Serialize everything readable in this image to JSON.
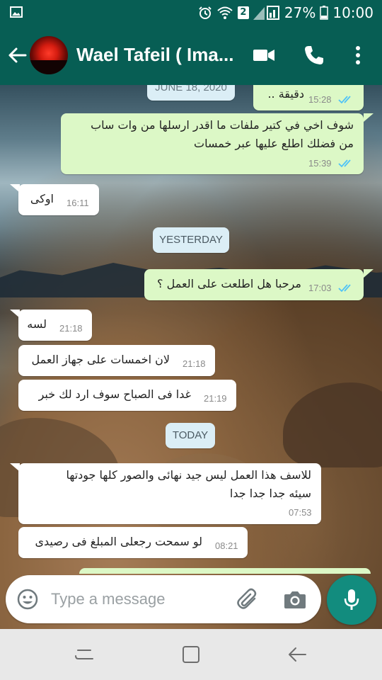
{
  "status_bar": {
    "battery": "27%",
    "time": "10:00",
    "sim_badge": "2",
    "icons": [
      "image-icon",
      "alarm-icon",
      "wifi-icon",
      "signal-icon",
      "battery-icon"
    ]
  },
  "header": {
    "contact_name": "Wael Tafeil ( Ima...",
    "actions": [
      "video-call-icon",
      "voice-call-icon",
      "more-options-icon"
    ]
  },
  "colors": {
    "header_bg": "#075e54",
    "outgoing_bubble": "#dcf8c6",
    "incoming_bubble": "#ffffff",
    "read_ticks": "#4fc3f7",
    "fab": "#128c7e"
  },
  "dates": {
    "partial": "JUNE 18, 2020",
    "yesterday": "YESTERDAY",
    "today": "TODAY"
  },
  "messages": [
    {
      "id": "m1",
      "direction": "out",
      "text": "دقيقة ..",
      "time": "15:28",
      "read": true
    },
    {
      "id": "m2",
      "direction": "out",
      "text_lines": [
        "شوف اخي في كتير ملفات ما اقدر ارسلها من وات ساب",
        "من فضلك اطلع عليها عبر خمسات"
      ],
      "time": "15:39",
      "read": true
    },
    {
      "id": "m3",
      "direction": "in",
      "text": "اوكى",
      "time": "16:11"
    },
    {
      "id": "m4",
      "direction": "out",
      "text": "مرحبا هل اطلعت على العمل ؟",
      "time": "17:03",
      "read": true
    },
    {
      "id": "m5",
      "direction": "in",
      "text": "لسه",
      "time": "21:18"
    },
    {
      "id": "m6",
      "direction": "in",
      "text": "لان اخمسات على جهاز العمل",
      "time": "21:18"
    },
    {
      "id": "m7",
      "direction": "in",
      "text": "غدا فى الصباح سوف ارد لك خبر",
      "time": "21:19"
    },
    {
      "id": "m8",
      "direction": "in",
      "text_lines": [
        "للاسف هذا العمل ليس جيد نهائى والصور كلها جودتها",
        "سيئه جدا جدا جدا"
      ],
      "time": "07:53"
    },
    {
      "id": "m9",
      "direction": "in",
      "text": "لو سمحت رجعلى المبلغ فى رصيدى",
      "time": "08:21"
    }
  ],
  "composer": {
    "placeholder": "Type a message",
    "value": "",
    "icons": [
      "emoji-icon",
      "attach-icon",
      "camera-icon",
      "mic-icon"
    ]
  },
  "nav_bar": {
    "icons": [
      "recents-icon",
      "home-icon",
      "back-icon"
    ]
  }
}
